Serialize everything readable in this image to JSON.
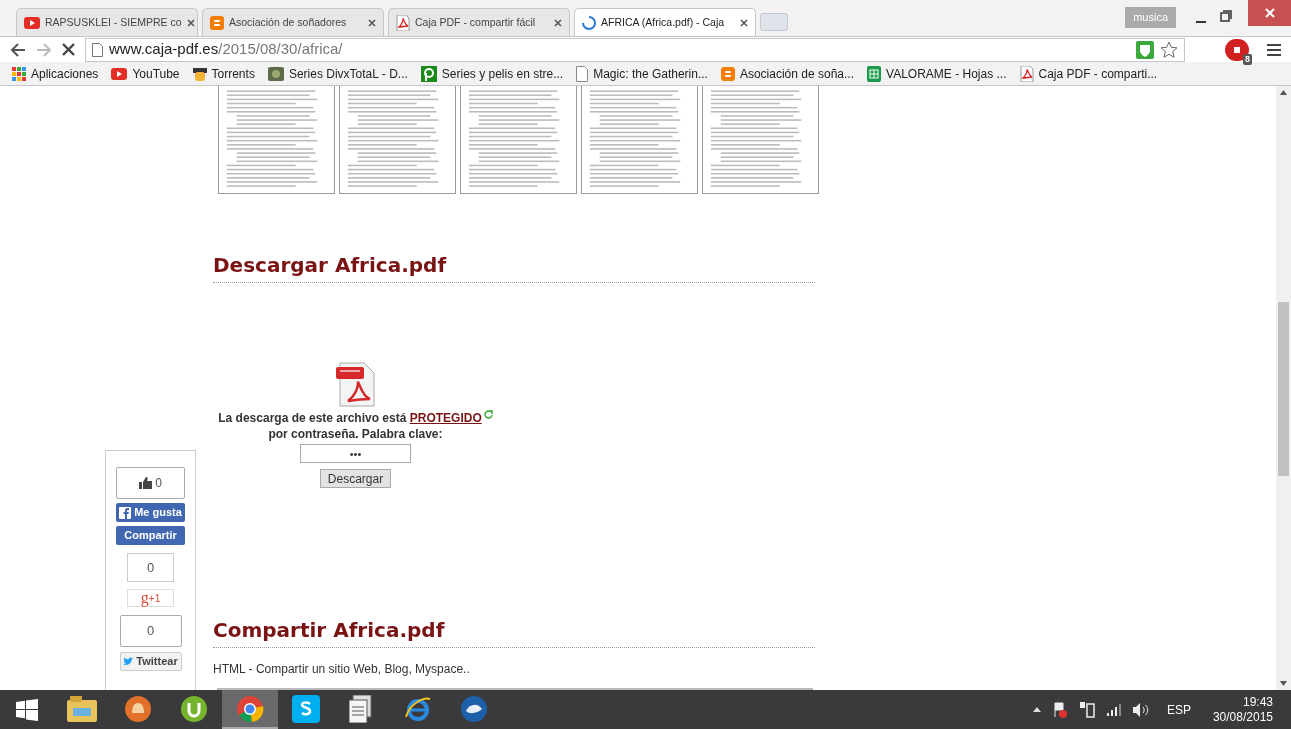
{
  "window": {
    "profile": "musica"
  },
  "tabs": [
    {
      "title": "RAPSUSKLEI - SIEMPRE co",
      "kind": "youtube",
      "selected": false
    },
    {
      "title": "Asociación de soñadores",
      "kind": "blogger",
      "selected": false
    },
    {
      "title": "Caja PDF - compartir fácil",
      "kind": "pdf",
      "selected": false
    },
    {
      "title": "AFRICA (Africa.pdf) - Caja",
      "kind": "loading",
      "selected": true
    }
  ],
  "address_bar": {
    "domain": "www.caja-pdf.es",
    "path": "/2015/08/30/africa/",
    "loading": true
  },
  "bookmarks": [
    {
      "label": "Aplicaciones",
      "kind": "apps"
    },
    {
      "label": "YouTube",
      "kind": "youtube"
    },
    {
      "label": "Torrents",
      "kind": "torrents"
    },
    {
      "label": "Series DivxTotaL - D...",
      "kind": "divx"
    },
    {
      "label": "Series y pelis en stre...",
      "kind": "pelis"
    },
    {
      "label": "Magic: the Gatherin...",
      "kind": "page"
    },
    {
      "label": "Asociación de soña...",
      "kind": "blogger"
    },
    {
      "label": "VALORAME - Hojas ...",
      "kind": "sheets"
    },
    {
      "label": "Caja PDF - comparti...",
      "kind": "pdf"
    }
  ],
  "extensions": {
    "abp_count": "8"
  },
  "download": {
    "heading": "Descargar Africa.pdf",
    "notice": "La descarga de este archivo está",
    "link": "PROTEGIDO",
    "notice_2": "por contraseña. Palabra clave:",
    "password_value": "•••",
    "button": "Descargar"
  },
  "share": {
    "heading": "Compartir Africa.pdf",
    "line": "HTML - Compartir un sitio Web, Blog, Myspace.."
  },
  "social_bar": {
    "like_count": "0",
    "like_button": "Me gusta",
    "share_button": "Compartir",
    "gplus_count": "0",
    "gplus_button": "+1",
    "gplus_glyph": "g",
    "tweet_count": "0",
    "tweet_button": "Twittear"
  },
  "taskbar": {
    "apps": [
      {
        "kind": "explorer",
        "selected": false
      },
      {
        "kind": "hand",
        "selected": false
      },
      {
        "kind": "utorrent",
        "selected": false
      },
      {
        "kind": "chrome",
        "selected": true
      },
      {
        "kind": "skype",
        "selected": false
      },
      {
        "kind": "files",
        "selected": false
      },
      {
        "kind": "ie",
        "selected": false
      },
      {
        "kind": "bird",
        "selected": false
      }
    ],
    "language": "ESP",
    "time": "19:43",
    "date": "30/08/2015"
  }
}
